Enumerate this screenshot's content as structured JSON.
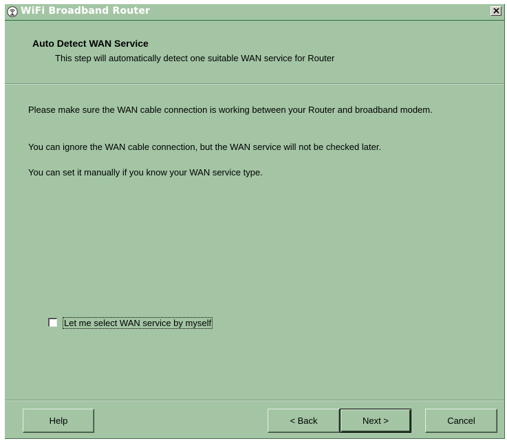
{
  "window": {
    "title": "WiFi Broadband Router",
    "title_icon": "router-globe-icon",
    "close_icon": "close-x-icon"
  },
  "header": {
    "title": "Auto Detect WAN Service",
    "subtitle": "This step will automatically detect one suitable WAN service for Router"
  },
  "content": {
    "paragraphs": [
      "Please make sure the WAN cable connection is working between your Router and broadband modem.",
      "You can ignore the WAN cable connection, but the WAN service will not be checked later.",
      "You can set it manually if you know your WAN service type."
    ]
  },
  "options": {
    "manual_select_label": "Let me select WAN service by myself",
    "manual_select_checked": false
  },
  "buttons": {
    "help": "Help",
    "back": "< Back",
    "next": "Next >",
    "cancel": "Cancel"
  },
  "colors": {
    "background": "#a3c5a4",
    "title_text": "#ffffff",
    "text": "#000000"
  }
}
